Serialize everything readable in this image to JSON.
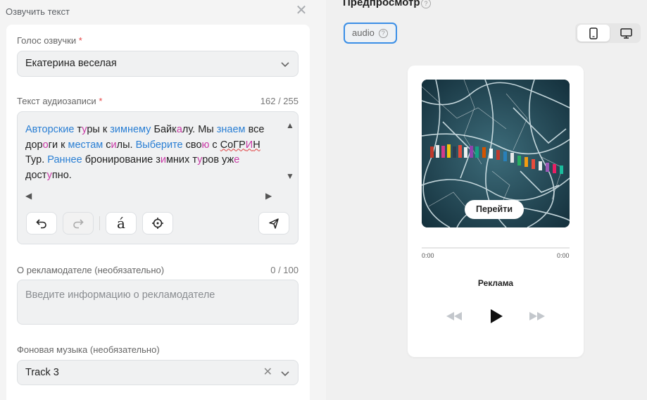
{
  "left_panel": {
    "header": "Озвучить текст",
    "close_icon": "close-icon"
  },
  "voice": {
    "label": "Голос озвучки",
    "required_mark": "*",
    "value": "Екатерина веселая"
  },
  "audio_text": {
    "label": "Текст аудиозаписи",
    "required_mark": "*",
    "counter": "162 / 255",
    "words": {
      "w1": "Авторские",
      "w2a": "т",
      "w2b": "у",
      "w2c": "ры",
      "w3": "к",
      "w4": "зимнему",
      "w5a": "Байк",
      "w5b": "а",
      "w5c": "лу.",
      "w6": "Мы",
      "w7": "знаем",
      "w8": "все",
      "w9a": "дор",
      "w9b": "о",
      "w9c": "ги",
      "w10": "к",
      "w11": "местам",
      "w12a": "с",
      "w12b": "и",
      "w12c": "лы.",
      "w13": "Выберите",
      "w14a": "сво",
      "w14b": "ю",
      "w15": "с",
      "w16a": "СоГР",
      "w16b": "И",
      "w16c": "Н",
      "w17": "Тур.",
      "w18": "Раннее",
      "w19": "бронирование",
      "w20a": "з",
      "w20b": "и",
      "w20c": "мних",
      "w21a": "т",
      "w21b": "у",
      "w21c": "ров",
      "w22a": "уж",
      "w22b": "е",
      "w23a": "дост",
      "w23b": "у",
      "w23c": "пно."
    },
    "toolbar_icons": [
      "undo-icon",
      "redo-icon",
      "stress-accent-icon",
      "crosshair-icon",
      "pronunciation-icon"
    ],
    "stress_glyph": "á"
  },
  "advertiser": {
    "label": "О рекламодателе (необязательно)",
    "counter": "0 / 100",
    "placeholder": "Введите информацию о рекламодателе"
  },
  "music": {
    "label": "Фоновая музыка (необязательно)",
    "value": "Track 3"
  },
  "preview": {
    "title": "Предпросмотр",
    "tab_audio": "audio",
    "device_mobile_icon": "smartphone-icon",
    "device_desktop_icon": "monitor-icon",
    "go_button": "Перейти",
    "time_start": "0:00",
    "time_end": "0:00",
    "ad_label": "Реклама",
    "controls": [
      "rewind-icon",
      "play-icon",
      "fast-forward-icon"
    ]
  },
  "colors": {
    "accent": "#3a8ee6",
    "word_highlight": "#2a7fd4",
    "stress_highlight": "#c93aa6",
    "required": "#e64646"
  }
}
